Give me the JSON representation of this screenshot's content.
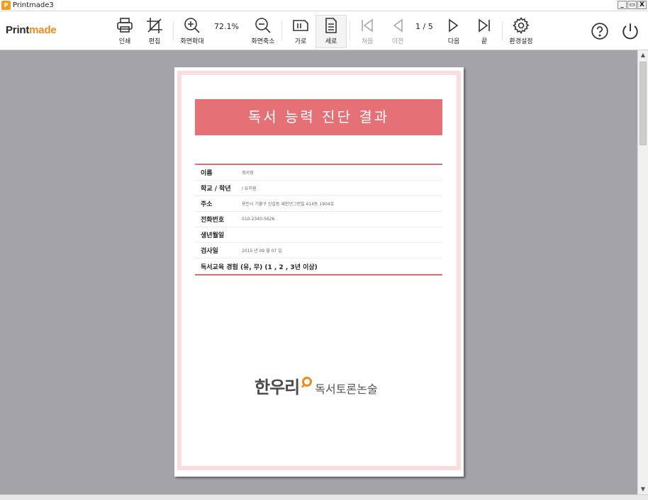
{
  "window": {
    "title": "Printmade3",
    "app_icon": "P",
    "controls": [
      "_",
      "▭",
      "X"
    ]
  },
  "toolbar": {
    "logo_main": "Print",
    "logo_accent": "made",
    "print": "인쇄",
    "edit": "편집",
    "zoom_in": "화면확대",
    "zoom_value": "72.1%",
    "zoom_out": "화면축소",
    "landscape": "가로",
    "portrait": "세로",
    "first": "처음",
    "prev": "이전",
    "page_indicator": "1  / 5",
    "next": "다음",
    "last": "끝",
    "settings": "환경설정"
  },
  "document": {
    "title": "독서 능력 진단 결과",
    "fields": [
      {
        "label": "이름",
        "value": "최서영"
      },
      {
        "label": "학교 / 학년",
        "value": "/ 유치원"
      },
      {
        "label": "주소",
        "value": "용인시 기흥구 신갈동 새천년그린빌 414동 1904호"
      },
      {
        "label": "전화번호",
        "value": "010-2340-5626"
      },
      {
        "label": "생년월일",
        "value": ""
      },
      {
        "label": "검사일",
        "value": "2015 년  09 월  07 일"
      },
      {
        "label": "독서교육 경험 (유, 무) (1 , 2 , 3년 이상)",
        "value": ""
      }
    ],
    "brand_left": "한우리",
    "brand_right": "독서토론논술"
  },
  "colors": {
    "accent": "#e57076",
    "frame": "#fbdde0",
    "workspace": "#a4a3a8",
    "logo_accent": "#f08a1c"
  }
}
